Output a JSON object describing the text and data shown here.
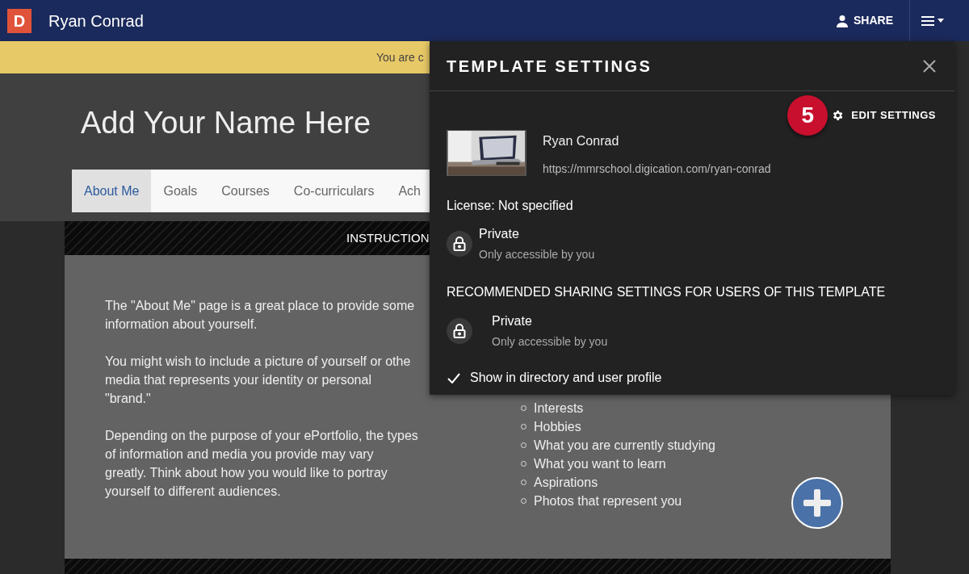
{
  "topbar": {
    "logo": "D",
    "title": "Ryan Conrad",
    "share": "SHARE"
  },
  "banner": {
    "text": "You are c"
  },
  "page_title": "Add Your Name Here",
  "tabs": [
    {
      "label": "About Me",
      "selected": true
    },
    {
      "label": "Goals",
      "selected": false
    },
    {
      "label": "Courses",
      "selected": false
    },
    {
      "label": "Co-curriculars",
      "selected": false
    },
    {
      "label": "Ach",
      "selected": false
    }
  ],
  "instructions_bar": {
    "title": "INSTRUCTION"
  },
  "paragraphs": [
    [
      "The \"About Me\" page is a great place to provide some",
      "information about yourself."
    ],
    [
      "You might wish to include a picture of yourself or othe",
      "media that represents your identity or personal",
      "\"brand.\""
    ],
    [
      "Depending on the purpose of your ePortfolio, the types",
      "of information and media you provide may vary",
      "greatly. Think about how you would like to portray",
      "yourself to different audiences."
    ]
  ],
  "list_items": [
    "Interests",
    "Hobbies",
    "What you are currently studying",
    "What you want to learn",
    "Aspirations",
    "Photos that represent you"
  ],
  "panel": {
    "title": "TEMPLATE SETTINGS",
    "step_badge": "5",
    "edit_settings": "EDIT SETTINGS",
    "owner": {
      "name": "Ryan Conrad",
      "url": "https://mmrschool.digication.com/ryan-conrad"
    },
    "license": "License: Not specified",
    "privacy": {
      "label": "Private",
      "description": "Only accessible by you"
    },
    "recommended_heading": "RECOMMENDED SHARING SETTINGS FOR USERS OF THIS TEMPLATE",
    "recommended_privacy": {
      "label": "Private",
      "description": "Only accessible by you"
    },
    "directory_option": {
      "label": "Show in directory and user profile",
      "checked": true
    }
  }
}
